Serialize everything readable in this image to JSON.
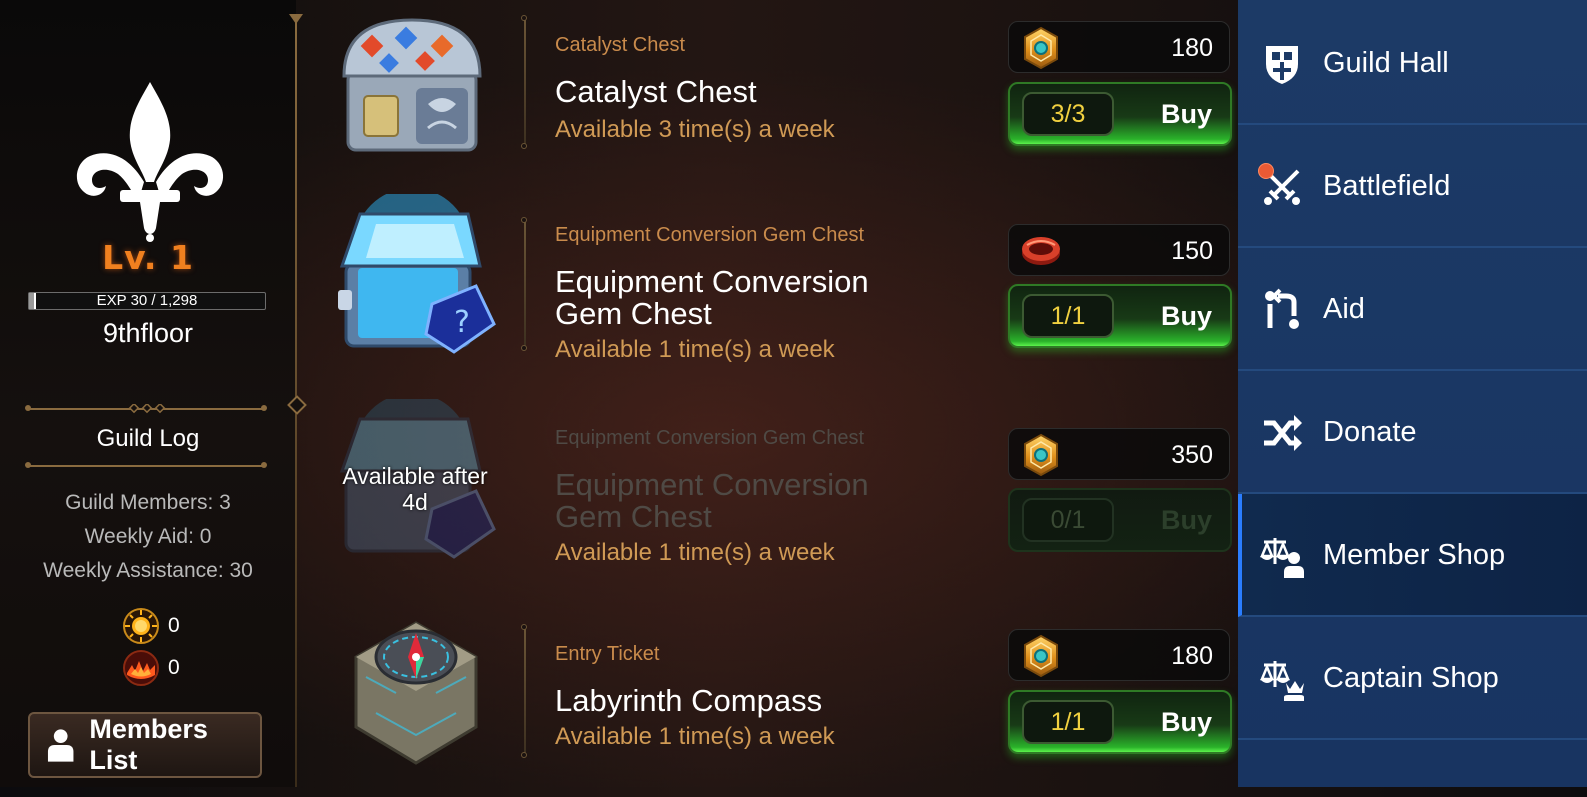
{
  "guild": {
    "level_text": "Lv.  1",
    "exp_text": "EXP 30 / 1,298",
    "exp_progress": 0.023,
    "name": "9thfloor",
    "log_label": "Guild Log",
    "members_text": "Guild Members: 3",
    "weekly_aid_text": "Weekly Aid: 0",
    "weekly_assistance_text": "Weekly Assistance: 30",
    "currency": [
      {
        "icon": "sun-coin-icon",
        "value": "0"
      },
      {
        "icon": "flame-orb-icon",
        "value": "0"
      }
    ],
    "members_button": "Members List"
  },
  "items": [
    {
      "category": "Catalyst Chest",
      "name": "Catalyst Chest",
      "limit": "Available 3 time(s) a week",
      "price": "180",
      "currency_icon": "gold-emblem-icon",
      "count": "3/3",
      "buy_label": "Buy",
      "image_icon": "catalyst-chest-icon"
    },
    {
      "category": "Equipment Conversion Gem Chest",
      "name": "Equipment Conversion Gem Chest",
      "limit": "Available 1 time(s) a week",
      "price": "150",
      "currency_icon": "red-ring-icon",
      "count": "1/1",
      "buy_label": "Buy",
      "image_icon": "gem-chest-icon"
    },
    {
      "category": "Equipment Conversion Gem Chest",
      "name": "Equipment Conversion Gem Chest",
      "limit": "Available 1 time(s) a week",
      "price": "350",
      "currency_icon": "gold-emblem-icon",
      "count": "0/1",
      "buy_label": "Buy",
      "availability_note": "Available after 4d",
      "image_icon": "gem-chest-icon"
    },
    {
      "category": "Entry Ticket",
      "name": "Labyrinth Compass",
      "limit": "Available 1 time(s) a week",
      "price": "180",
      "currency_icon": "gold-emblem-icon",
      "count": "1/1",
      "buy_label": "Buy",
      "image_icon": "compass-icon"
    }
  ],
  "nav": [
    {
      "label": "Guild Hall",
      "icon": "guild-hall-icon",
      "active": false
    },
    {
      "label": "Battlefield",
      "icon": "crossed-swords-icon",
      "active": false,
      "notification": true
    },
    {
      "label": "Aid",
      "icon": "aid-icon",
      "active": false
    },
    {
      "label": "Donate",
      "icon": "shuffle-icon",
      "active": false
    },
    {
      "label": "Member Shop",
      "icon": "member-shop-icon",
      "active": true
    },
    {
      "label": "Captain Shop",
      "icon": "captain-shop-icon",
      "active": false
    }
  ],
  "colors": {
    "level": "#f0801f",
    "category": "#c98b4c",
    "limit": "#d09a55",
    "count": "#f0d040",
    "buy_green": "#2ab22a",
    "nav_bg": "#1c3a66",
    "nav_active_bar": "#2a7dff"
  }
}
